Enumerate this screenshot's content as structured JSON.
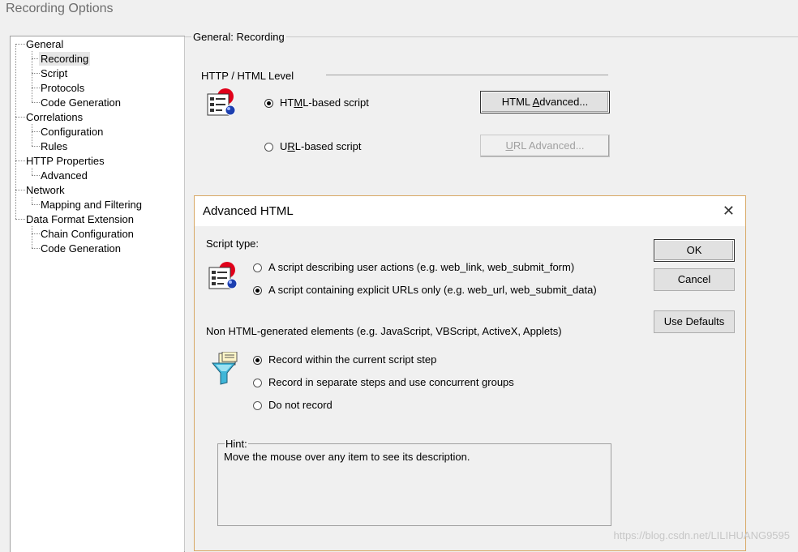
{
  "window": {
    "title": "Recording Options"
  },
  "tree": {
    "items": [
      {
        "label": "General"
      },
      {
        "label": "Recording"
      },
      {
        "label": "Script"
      },
      {
        "label": "Protocols"
      },
      {
        "label": "Code Generation"
      },
      {
        "label": "Correlations"
      },
      {
        "label": "Configuration"
      },
      {
        "label": "Rules"
      },
      {
        "label": "HTTP Properties"
      },
      {
        "label": "Advanced"
      },
      {
        "label": "Network"
      },
      {
        "label": "Mapping and Filtering"
      },
      {
        "label": "Data Format Extension"
      },
      {
        "label": "Chain Configuration"
      },
      {
        "label": "Code Generation"
      }
    ]
  },
  "panel": {
    "group_label": "General: Recording",
    "section_label": "HTTP / HTML Level",
    "html_radio": {
      "pre": "HT",
      "accel": "M",
      "post": "L-based script"
    },
    "url_radio": {
      "pre": "U",
      "accel": "R",
      "post": "L-based script"
    },
    "html_adv_btn": {
      "pre": "HTML ",
      "accel": "A",
      "post": "dvanced..."
    },
    "url_adv_btn": {
      "pre": "",
      "accel": "U",
      "post": "RL Advanced..."
    }
  },
  "dialog": {
    "title": "Advanced HTML",
    "close_glyph": "✕",
    "script_type_label": "Script type:",
    "script_opt1": "A script describing user actions (e.g. web_link, web_submit_form)",
    "script_opt2": "A script containing explicit URLs only (e.g. web_url, web_submit_data)",
    "non_html_label": "Non HTML-generated elements (e.g. JavaScript, VBScript, ActiveX, Applets)",
    "non_opt1": "Record within the current script step",
    "non_opt2": "Record in separate steps and use concurrent groups",
    "non_opt3": "Do not record",
    "hint_label": "Hint:",
    "hint_text": "Move the mouse over any item to see its description.",
    "ok": "OK",
    "cancel": "Cancel",
    "use_defaults": "Use Defaults"
  },
  "state": {
    "panel_selected": "html",
    "script_selected": 2,
    "non_html_selected": 1
  },
  "watermark": "https://blog.csdn.net/LILIHUANG9595"
}
